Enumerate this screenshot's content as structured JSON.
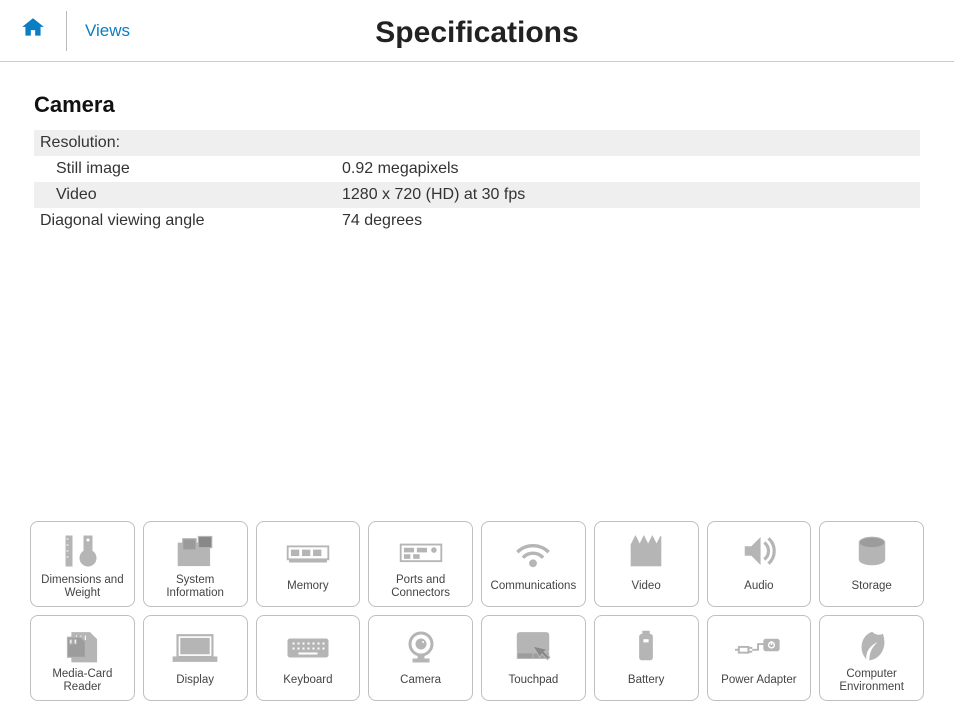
{
  "header": {
    "views_label": "Views",
    "page_title": "Specifications"
  },
  "section": {
    "heading": "Camera",
    "rows": [
      {
        "label": "Resolution:",
        "value": "",
        "indent": false
      },
      {
        "label": "Still image",
        "value": "0.92 megapixels",
        "indent": true
      },
      {
        "label": "Video",
        "value": "1280 x 720 (HD) at 30 fps",
        "indent": true
      },
      {
        "label": "Diagonal viewing angle",
        "value": "74 degrees",
        "indent": false
      }
    ]
  },
  "nav": [
    {
      "id": "dimensions-weight",
      "label": "Dimensions and\nWeight",
      "icon": "dimensions"
    },
    {
      "id": "system-information",
      "label": "System\nInformation",
      "icon": "systeminfo"
    },
    {
      "id": "memory",
      "label": "Memory",
      "icon": "memory"
    },
    {
      "id": "ports-connectors",
      "label": "Ports and\nConnectors",
      "icon": "ports"
    },
    {
      "id": "communications",
      "label": "Communications",
      "icon": "wifi"
    },
    {
      "id": "video",
      "label": "Video",
      "icon": "video"
    },
    {
      "id": "audio",
      "label": "Audio",
      "icon": "audio"
    },
    {
      "id": "storage",
      "label": "Storage",
      "icon": "storage"
    },
    {
      "id": "media-card-reader",
      "label": "Media-Card\nReader",
      "icon": "sdcard"
    },
    {
      "id": "display",
      "label": "Display",
      "icon": "display"
    },
    {
      "id": "keyboard",
      "label": "Keyboard",
      "icon": "keyboard"
    },
    {
      "id": "camera",
      "label": "Camera",
      "icon": "camera"
    },
    {
      "id": "touchpad",
      "label": "Touchpad",
      "icon": "touchpad"
    },
    {
      "id": "battery",
      "label": "Battery",
      "icon": "battery"
    },
    {
      "id": "power-adapter",
      "label": "Power Adapter",
      "icon": "power"
    },
    {
      "id": "computer-environment",
      "label": "Computer\nEnvironment",
      "icon": "leaf"
    }
  ]
}
